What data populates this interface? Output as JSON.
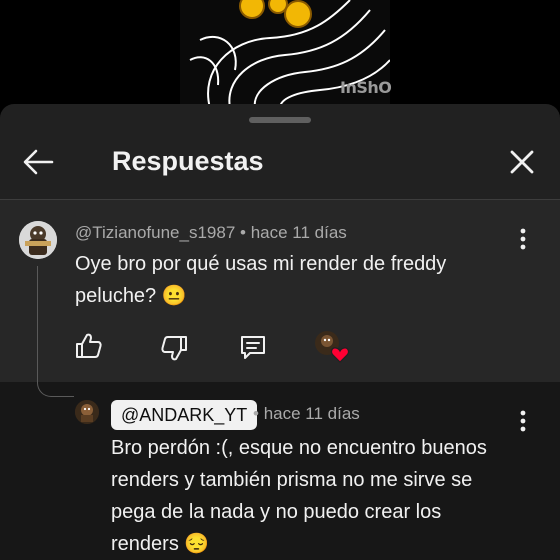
{
  "video": {
    "watermark": "InShO",
    "icon": "inshot-watermark"
  },
  "panel": {
    "title": "Respuestas",
    "back_icon": "back-arrow-icon",
    "close_icon": "close-icon"
  },
  "comment": {
    "author": "@Tizianofune_s1987",
    "separator": "•",
    "time": "hace 11 días",
    "text_line1": "Oye bro por qué usas mi render de freddy",
    "text_line2": "peluche? 😐",
    "actions": [
      "like-icon",
      "dislike-icon",
      "reply-icon",
      "creator-heart-icon"
    ]
  },
  "reply": {
    "author": "@ANDARK_YT",
    "separator": "•",
    "time": "hace 11 días",
    "text_lines": [
      "Bro perdón :(, esque no encuentro buenos",
      "renders y también prisma no me sirve se",
      "pega de la nada y no puedo crear los",
      "renders 😔"
    ]
  },
  "colors": {
    "sheet": "#212121",
    "highlight": "#272727",
    "text": "#f1f1f1",
    "meta": "#aaaaaa",
    "heart": "#ff0033",
    "chip": "#f1f1f1"
  }
}
